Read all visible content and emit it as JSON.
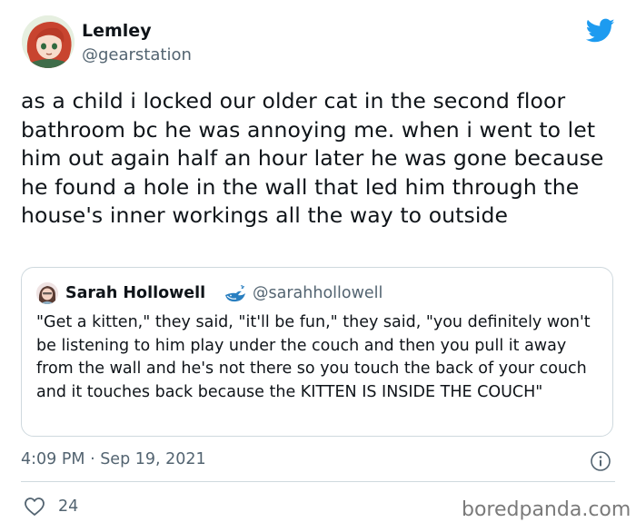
{
  "tweet": {
    "author_name": "Lemley",
    "author_handle": "@gearstation",
    "text": "as a child i locked our older cat in the second floor bathroom bc he was annoying me. when i went to let him out again half an hour later he was gone because he found a hole in the wall that led him through the house's inner workings all the way to outside",
    "timestamp": "4:09 PM · Sep 19, 2021",
    "like_count": "24"
  },
  "quoted": {
    "author_name": "Sarah Hollowell",
    "author_handle": "@sarahhollowell",
    "text": "\"Get a kitten,\" they said, \"it'll be fun,\" they said, \"you definitely won't be listening to him play under the couch and then you pull it away from the wall and he's not there so you touch the back of your couch and it touches back because the KITTEN IS INSIDE THE COUCH\""
  },
  "watermark": "boredpanda.com",
  "icons": {
    "brand": "twitter-bird-icon",
    "badge": "whale-icon",
    "info": "info-icon",
    "like": "heart-icon"
  },
  "colors": {
    "twitter_blue": "#1d9bf0",
    "text": "#0f1419",
    "secondary": "#536471",
    "border": "#cfd9de"
  }
}
